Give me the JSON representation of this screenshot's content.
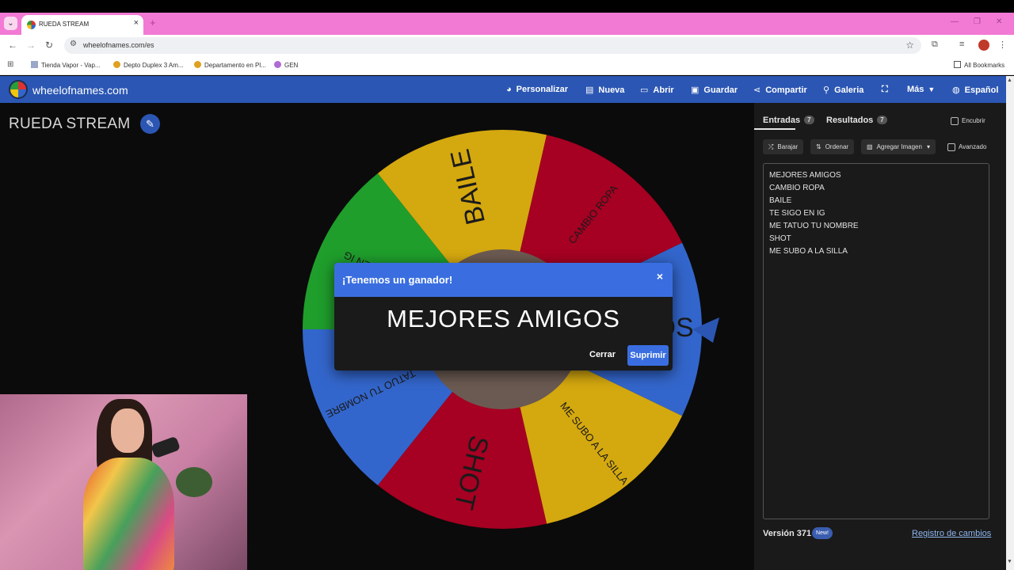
{
  "browser": {
    "tab_title": "RUEDA STREAM",
    "tab_close": "×",
    "new_tab": "+",
    "url": "wheelofnames.com/es",
    "bookmarks": [
      {
        "label": "Tienda Vapor - Vap..."
      },
      {
        "label": "Depto Duplex 3 Am..."
      },
      {
        "label": "Departamento en Pl..."
      },
      {
        "label": "GEN"
      }
    ],
    "all_bookmarks": "All Bookmarks"
  },
  "site": {
    "name": "wheelofnames.com",
    "nav": [
      {
        "label": "Personalizar",
        "icon": "palette-icon"
      },
      {
        "label": "Nueva",
        "icon": "file-icon"
      },
      {
        "label": "Abrir",
        "icon": "folder-open-icon"
      },
      {
        "label": "Guardar",
        "icon": "save-icon"
      },
      {
        "label": "Compartir",
        "icon": "share-icon"
      },
      {
        "label": "Galeria",
        "icon": "search-icon"
      },
      {
        "label": "",
        "icon": "fullscreen-icon"
      },
      {
        "label": "Más",
        "icon": "chevron-down-icon"
      },
      {
        "label": "Español",
        "icon": "globe-icon"
      }
    ]
  },
  "wheel": {
    "title": "RUEDA STREAM",
    "segments": [
      {
        "label": "MEJORES AMIGOS",
        "color": "#3366cc",
        "visible_text": "MIGOS"
      },
      {
        "label": "ME SUBO A LA SILLA",
        "color": "#d4a80f"
      },
      {
        "label": "SHOT",
        "color": "#a60022"
      },
      {
        "label": "ME TATUO TU NOMBRE",
        "color": "#3366cc",
        "visible_text": "TATUO TU NOMBRE"
      },
      {
        "label": "TE SIGO EN IG",
        "color": "#1f9e2c",
        "visible_text": "SIGO EN IG"
      },
      {
        "label": "BAILE",
        "color": "#d4a80f"
      },
      {
        "label": "CAMBIO ROPA",
        "color": "#a60022"
      }
    ]
  },
  "dialog": {
    "title": "¡Tenemos un ganador!",
    "close_icon": "×",
    "winner": "MEJORES AMIGOS",
    "cerrar": "Cerrar",
    "suprimir": "Suprimir"
  },
  "panel": {
    "tab_entries": "Entradas",
    "tab_entries_count": "7",
    "tab_results": "Resultados",
    "tab_results_count": "7",
    "hide_label": "Encubrir",
    "shuffle": "Barajar",
    "sort": "Ordenar",
    "add_image": "Agregar Imagen",
    "advanced": "Avanzado",
    "entries": [
      "MEJORES AMIGOS",
      "CAMBIO ROPA",
      "BAILE",
      "TE SIGO EN IG",
      "ME TATUO TU NOMBRE",
      "SHOT",
      "ME SUBO A LA SILLA"
    ],
    "version": "Versión 371",
    "new_badge": "New!",
    "changelog": "Registro de cambios"
  },
  "colors": {
    "site_blue": "#2b56b3",
    "dialog_blue": "#3a6ee0",
    "tabstrip_pink": "#f27ad4"
  }
}
